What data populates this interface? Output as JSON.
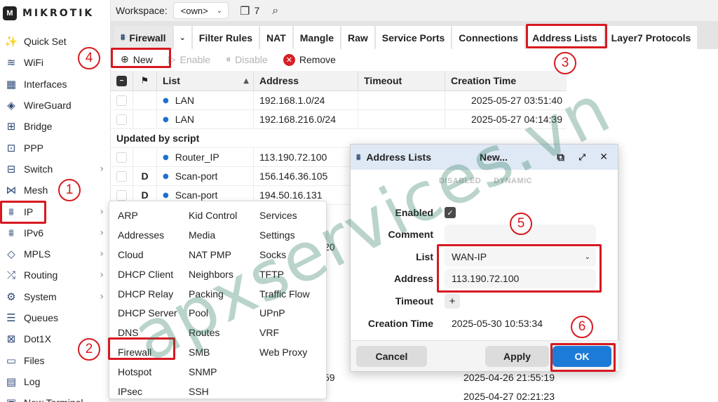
{
  "brand": {
    "logo_text": "MIKROTIK"
  },
  "sidebar": {
    "items": [
      {
        "label": "Quick Set",
        "icon": "wand-icon",
        "glyph": "✨",
        "submenu": false
      },
      {
        "label": "WiFi",
        "icon": "wifi-icon",
        "glyph": "≋",
        "submenu": false
      },
      {
        "label": "Interfaces",
        "icon": "interfaces-icon",
        "glyph": "▦",
        "submenu": false
      },
      {
        "label": "WireGuard",
        "icon": "wireguard-icon",
        "glyph": "◈",
        "submenu": false
      },
      {
        "label": "Bridge",
        "icon": "bridge-icon",
        "glyph": "⊞",
        "submenu": false
      },
      {
        "label": "PPP",
        "icon": "ppp-icon",
        "glyph": "⊡",
        "submenu": false
      },
      {
        "label": "Switch",
        "icon": "switch-icon",
        "glyph": "⊟",
        "submenu": true
      },
      {
        "label": "Mesh",
        "icon": "mesh-icon",
        "glyph": "⋈",
        "submenu": false
      },
      {
        "label": "IP",
        "icon": "ip-icon",
        "glyph": "⩩",
        "submenu": true
      },
      {
        "label": "IPv6",
        "icon": "ipv6-icon",
        "glyph": "⩩",
        "submenu": true
      },
      {
        "label": "MPLS",
        "icon": "mpls-icon",
        "glyph": "◇",
        "submenu": true
      },
      {
        "label": "Routing",
        "icon": "routing-icon",
        "glyph": "⤮",
        "submenu": true
      },
      {
        "label": "System",
        "icon": "gear-icon",
        "glyph": "⚙",
        "submenu": true
      },
      {
        "label": "Queues",
        "icon": "queues-icon",
        "glyph": "☰",
        "submenu": false
      },
      {
        "label": "Dot1X",
        "icon": "dot1x-icon",
        "glyph": "⊠",
        "submenu": false
      },
      {
        "label": "Files",
        "icon": "folder-icon",
        "glyph": "▭",
        "submenu": false
      },
      {
        "label": "Log",
        "icon": "log-icon",
        "glyph": "▤",
        "submenu": false
      },
      {
        "label": "New Terminal",
        "icon": "terminal-icon",
        "glyph": "▣",
        "submenu": false
      }
    ]
  },
  "topbar": {
    "workspace_label": "Workspace:",
    "workspace_value": "<own>",
    "window_count": "7"
  },
  "tabs": [
    {
      "label": "Firewall",
      "kind": "first"
    },
    {
      "label": "Filter Rules"
    },
    {
      "label": "NAT"
    },
    {
      "label": "Mangle"
    },
    {
      "label": "Raw"
    },
    {
      "label": "Service Ports"
    },
    {
      "label": "Connections"
    },
    {
      "label": "Address Lists"
    },
    {
      "label": "Layer7 Protocols"
    }
  ],
  "toolbar": {
    "new_label": "New",
    "enable_label": "Enable",
    "disable_label": "Disable",
    "remove_label": "Remove"
  },
  "table": {
    "columns": {
      "list": "List",
      "address": "Address",
      "timeout": "Timeout",
      "creation_time": "Creation Time"
    },
    "rows": [
      {
        "flag": "",
        "list": "LAN",
        "address": "192.168.1.0/24",
        "timeout": "",
        "creation": "2025-05-27 03:51:40"
      },
      {
        "flag": "",
        "list": "LAN",
        "address": "192.168.216.0/24",
        "timeout": "",
        "creation": "2025-05-27 04:14:39"
      }
    ],
    "group_label": "Updated by script",
    "group_rows": [
      {
        "flag": "",
        "list": "Router_IP",
        "address": "113.190.72.100",
        "timeout": "",
        "creation": ""
      },
      {
        "flag": "D",
        "list": "Scan-port",
        "address": "156.146.36.105",
        "timeout": "",
        "creation": ""
      },
      {
        "flag": "D",
        "list": "Scan-port",
        "address": "194.50.16.131",
        "timeout": "",
        "creation": ""
      }
    ],
    "partial": {
      "address_fragment": "20",
      "creation_1": "2025-04-26 21:55:19",
      "creation_2": "2025-04-27 02:21:23",
      "timeout_fragment": "59"
    }
  },
  "ip_submenu": {
    "col1": [
      "ARP",
      "Addresses",
      "Cloud",
      "DHCP Client",
      "DHCP Relay",
      "DHCP Server",
      "DNS",
      "Firewall",
      "Hotspot",
      "IPsec"
    ],
    "col2": [
      "Kid Control",
      "Media",
      "NAT PMP",
      "Neighbors",
      "Packing",
      "Pool",
      "Routes",
      "SMB",
      "SNMP",
      "SSH"
    ],
    "col3": [
      "Services",
      "Settings",
      "Socks",
      "TFTP",
      "Traffic Flow",
      "UPnP",
      "VRF",
      "Web Proxy"
    ]
  },
  "dialog": {
    "title": "Address Lists",
    "state": "New...",
    "flag_disabled": "DISABLED",
    "flag_dynamic": "DYNAMIC",
    "enabled_label": "Enabled",
    "enabled_checked": true,
    "comment_label": "Comment",
    "comment_value": "",
    "list_label": "List",
    "list_value": "WAN-IP",
    "address_label": "Address",
    "address_value": "113.190.72.100",
    "timeout_label": "Timeout",
    "creation_label": "Creation Time",
    "creation_value": "2025-05-30 10:53:34",
    "cancel_label": "Cancel",
    "apply_label": "Apply",
    "ok_label": "OK"
  },
  "annotations": {
    "steps": [
      "1",
      "2",
      "3",
      "4",
      "5",
      "6"
    ],
    "highlight_color": "#d71920"
  },
  "watermark": "apxservices.vn",
  "colors": {
    "accent_blue": "#1d7bd8",
    "remove_red": "#d81f26",
    "dialog_header": "#dfe9f5"
  }
}
